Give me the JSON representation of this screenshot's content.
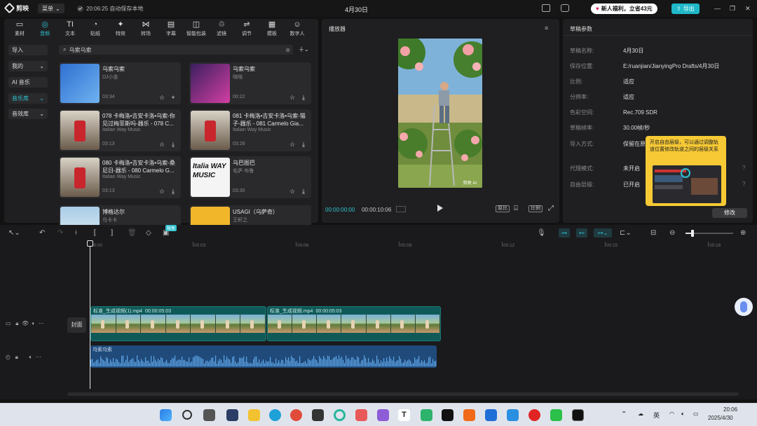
{
  "app": {
    "name": "剪映",
    "menu": "菜单",
    "autosave": "20:06:25 自动保存本地",
    "project_title": "4月30日",
    "promo": "新人福利，立省43元",
    "export": "导出"
  },
  "tabs": [
    {
      "label": "素材",
      "icon": "▭"
    },
    {
      "label": "音频",
      "icon": "◎"
    },
    {
      "label": "文本",
      "icon": "TI"
    },
    {
      "label": "贴纸",
      "icon": "◔"
    },
    {
      "label": "特效",
      "icon": "✦"
    },
    {
      "label": "转场",
      "icon": "⋈"
    },
    {
      "label": "字幕",
      "icon": "▤"
    },
    {
      "label": "智能包装",
      "icon": "◫"
    },
    {
      "label": "滤镜",
      "icon": "♲"
    },
    {
      "label": "调节",
      "icon": "⇌"
    },
    {
      "label": "模板",
      "icon": "▦"
    },
    {
      "label": "数字人",
      "icon": "☺"
    }
  ],
  "active_tab": "音频",
  "sidebar": [
    {
      "label": "导入",
      "arrow": ""
    },
    {
      "label": "我的",
      "arrow": "⌄"
    },
    {
      "label": "AI 音乐",
      "arrow": ""
    },
    {
      "label": "音乐库",
      "arrow": "⌄"
    },
    {
      "label": "音效库",
      "arrow": "⌄"
    }
  ],
  "search": {
    "value": "乌索乌索",
    "filter_icon": "filter-icon"
  },
  "cards": [
    {
      "title": "乌索乌索",
      "artist": "DJ小金",
      "duration": "03:34"
    },
    {
      "title": "乌索乌索",
      "artist": "嗡嗡",
      "duration": "00:22"
    },
    {
      "title": "078 卡梅洛•吉安卡洛•乌索-你见过梅菲斯吗-器乐 - 078 C...",
      "artist": "Italian Way Music",
      "duration": "03:13"
    },
    {
      "title": "081 卡梅洛•吉安卡洛•乌索-猫子-器乐 - 081 Carmelo Gia...",
      "artist": "Italian Way Music",
      "duration": "03:26"
    },
    {
      "title": "080 卡梅洛•吉安卡洛•乌索-桑尼日-器乐 - 080 Carmelo G...",
      "artist": "Italian Way Music",
      "duration": "03:13"
    },
    {
      "title": "乌巴图巴",
      "artist": "毛萨·布鲁",
      "duration": "03:30"
    },
    {
      "title": "博格达尔",
      "artist": "乌卡卡",
      "duration": ""
    },
    {
      "title": "USAGI（乌萨奇）",
      "artist": "王轩之",
      "duration": ""
    }
  ],
  "player": {
    "title": "播放器",
    "current": "00:00:00:00",
    "total": "00:00:10:06",
    "btn_full": "原比",
    "btn_ratio": "比例",
    "watermark": "剪映 AI"
  },
  "props": {
    "title": "草稿参数",
    "rows": [
      {
        "k": "草稿名称:",
        "v": "4月30日"
      },
      {
        "k": "保存位置:",
        "v": "E:/ruanjian/JianyingPro Drafts/4月30日"
      },
      {
        "k": "比例:",
        "v": "适应"
      },
      {
        "k": "分辨率:",
        "v": "适应"
      },
      {
        "k": "色彩空间:",
        "v": "Rec.709 SDR"
      },
      {
        "k": "草稿帧率:",
        "v": "30.00帧/秒"
      },
      {
        "k": "导入方式:",
        "v": "保留在原处"
      },
      {
        "k": "代理模式:",
        "v": "未开启"
      },
      {
        "k": "自由层级:",
        "v": "已开启"
      }
    ],
    "tooltip": "开启自由层级，可以通过调整轨道位置修改轨道之间的层级关系",
    "modify": "修改"
  },
  "toolbar": {
    "badge": "限免"
  },
  "timeline": {
    "ticks": [
      "00:00",
      "00:03",
      "00:06",
      "00:09",
      "00:12",
      "00:15",
      "00:18"
    ],
    "cover": "封面",
    "clips": [
      {
        "name": "标准_生成视频(1).mp4",
        "dur": "00:00:05:03"
      },
      {
        "name": "标准_生成视频.mp4",
        "dur": "00:00:05:03"
      }
    ],
    "audio_name": "乌索乌索"
  },
  "taskbar": {
    "lang": "英",
    "time": "20:06",
    "date": "2025/4/30"
  }
}
